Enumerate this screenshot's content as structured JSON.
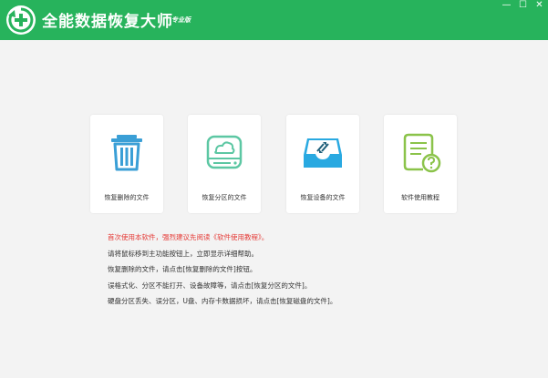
{
  "app": {
    "title": "全能数据恢复大师",
    "edition": "专业版",
    "brand_color": "#27b35c"
  },
  "window_controls": {
    "minimize": "—",
    "maximize": "☐",
    "close": "✕"
  },
  "cards": [
    {
      "label": "恢复删除的文件",
      "icon": "trash-icon",
      "color": "#3a9fd6"
    },
    {
      "label": "恢复分区的文件",
      "icon": "hard-drive-icon",
      "color": "#5cc7a3"
    },
    {
      "label": "恢复设备的文件",
      "icon": "device-tray-icon",
      "color": "#29a9e1"
    },
    {
      "label": "软件使用教程",
      "icon": "help-document-icon",
      "color": "#8bc34a"
    }
  ],
  "notes": {
    "warning": "首次使用本软件，强烈建议先阅读《软件使用教程》。",
    "lines": [
      "请将鼠标移到主功能按钮上，立即显示详细帮助。",
      "恢复删除的文件，请点击[恢复删除的文件]按钮。",
      "误格式化、分区不能打开、设备故障等，请点击[恢复分区的文件]。",
      "硬盘分区丢失、误分区，U盘、内存卡数据损坏，请点击[恢复磁盘的文件]。"
    ],
    "warning_color": "#e53935"
  }
}
